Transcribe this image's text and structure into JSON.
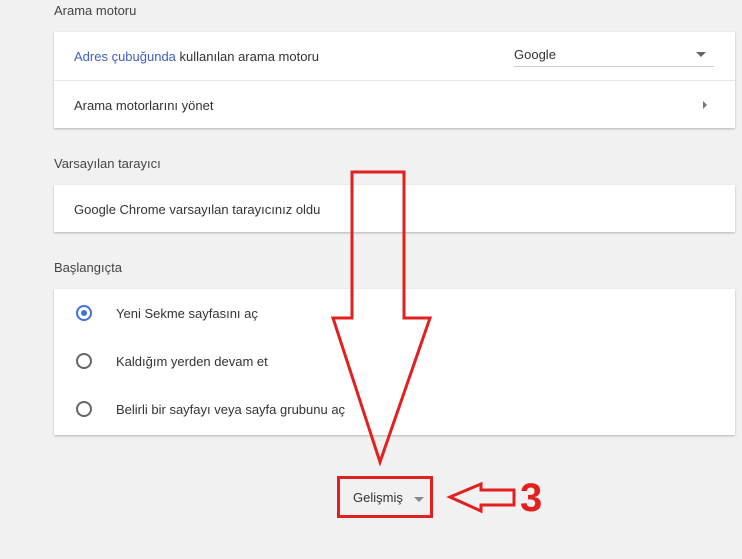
{
  "search_engine": {
    "heading": "Arama motoru",
    "address_bar_link": "Adres çubuğunda",
    "address_bar_rest": " kullanılan arama motoru",
    "selected_engine": "Google",
    "manage_label": "Arama motorlarını yönet"
  },
  "default_browser": {
    "heading": "Varsayılan tarayıcı",
    "status": "Google Chrome varsayılan tarayıcınız oldu"
  },
  "startup": {
    "heading": "Başlangıçta",
    "options": [
      {
        "label": "Yeni Sekme sayfasını aç",
        "selected": true
      },
      {
        "label": "Kaldığım yerden devam et",
        "selected": false
      },
      {
        "label": "Belirli bir sayfayı veya sayfa grubunu aç",
        "selected": false
      }
    ]
  },
  "advanced": {
    "label": "Gelişmiş"
  },
  "annotation": {
    "step_number": "3",
    "color": "#e32020"
  }
}
